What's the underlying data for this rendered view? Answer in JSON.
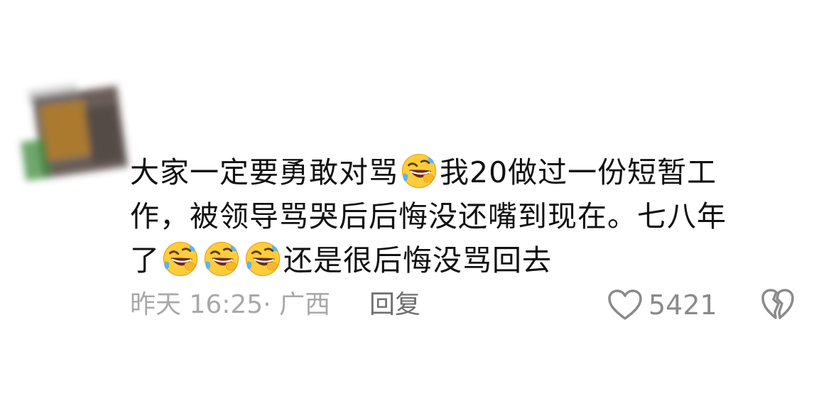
{
  "comment": {
    "line1_a": "大家一定要勇敢对骂",
    "line1_b": "我20做过一份短暂工",
    "line2": "作，被领导骂哭后后悔没还嘴到现在。七八年",
    "line3_a": "了",
    "line3_b": "还是很后悔没骂回去",
    "emoji_name": "rolling-on-floor-laughing"
  },
  "meta": {
    "time_location": "昨天 16:25· 广西",
    "reply_label": "回复",
    "like_count": "5421"
  },
  "colors": {
    "text": "#111111",
    "meta": "#a8a8a8",
    "icon": "#8a8a8a"
  }
}
